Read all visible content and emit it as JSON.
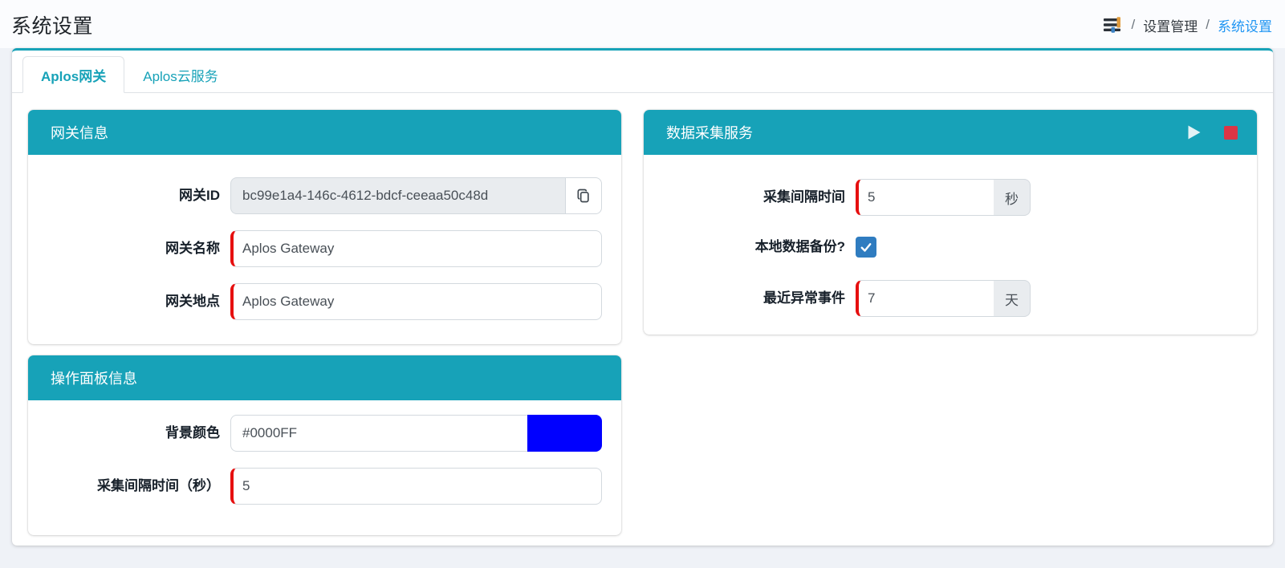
{
  "header": {
    "title": "系统设置",
    "breadcrumb": {
      "icon": "sliders-icon",
      "separator": "/",
      "items": [
        {
          "label": "设置管理"
        },
        {
          "label": "系统设置"
        }
      ]
    }
  },
  "tabs": [
    {
      "label": "Aplos网关",
      "active": true
    },
    {
      "label": "Aplos云服务",
      "active": false
    }
  ],
  "panels": {
    "gateway": {
      "title": "网关信息",
      "fields": [
        {
          "label": "网关ID",
          "value": "bc99e1a4-146c-4612-bdcf-ceeaa50c48d",
          "readonly": true,
          "action_icon": "copy-icon"
        },
        {
          "label": "网关名称",
          "value": "Aplos Gateway",
          "required": true
        },
        {
          "label": "网关地点",
          "value": "Aplos Gateway",
          "required": true
        }
      ]
    },
    "ops_panel": {
      "title": "操作面板信息",
      "fields": [
        {
          "label": "背景颜色",
          "value": "#0000FF",
          "swatch_color": "#0000FF"
        },
        {
          "label": "采集间隔时间（秒）",
          "value": "5",
          "required": true
        }
      ]
    },
    "data_collection": {
      "title": "数据采集服务",
      "controls": [
        {
          "icon": "play-icon"
        },
        {
          "icon": "stop-icon"
        }
      ],
      "fields": [
        {
          "label": "采集间隔时间",
          "value": "5",
          "suffix": "秒",
          "required": true
        },
        {
          "label": "本地数据备份?",
          "type": "checkbox",
          "checked": true
        },
        {
          "label": "最近异常事件",
          "value": "7",
          "suffix": "天",
          "required": true
        }
      ]
    }
  },
  "colors": {
    "accent_teal": "#17a2b8",
    "breadcrumb_link_blue": "#2196f3",
    "required_red": "#e60f0f",
    "stop_red": "#dc3545",
    "play_light": "#e3f2f5",
    "checkbox_blue": "#2f7cc0",
    "swatch_blue": "#0000FF",
    "readonly_gray": "#e9ecef"
  }
}
